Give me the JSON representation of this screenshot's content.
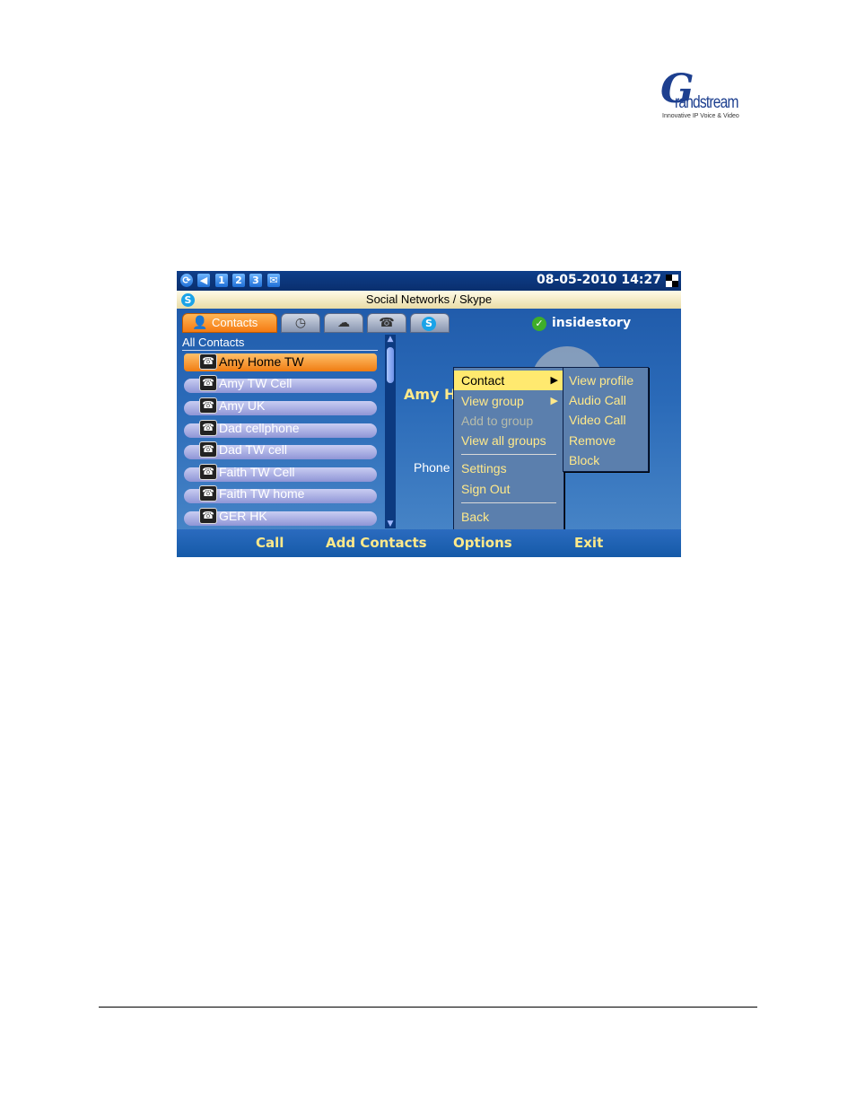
{
  "logo": {
    "letter": "G",
    "word": "randstream",
    "tagline": "Innovative IP Voice & Video"
  },
  "status_bar": {
    "icons": [
      "sync-icon",
      "volume-icon",
      "line-1",
      "line-2",
      "line-3",
      "message-icon"
    ],
    "lines": [
      "1",
      "2",
      "3"
    ],
    "datetime": "08-05-2010 14:27"
  },
  "title_bar": {
    "logo_letter": "S",
    "title": "Social Networks / Skype"
  },
  "tabs": [
    {
      "label": "Contacts",
      "icon": "contacts-icon",
      "active": true
    },
    {
      "label": "",
      "icon": "clock-icon",
      "active": false
    },
    {
      "label": "",
      "icon": "status-icon",
      "active": false
    },
    {
      "label": "",
      "icon": "phone-icon",
      "active": false
    },
    {
      "label": "",
      "icon": "skype-icon",
      "active": false
    }
  ],
  "user": {
    "name": "insidestory"
  },
  "list": {
    "header": "All Contacts",
    "contacts": [
      {
        "name": "Amy Home TW",
        "selected": true
      },
      {
        "name": "Amy TW Cell"
      },
      {
        "name": "Amy UK"
      },
      {
        "name": "Dad cellphone"
      },
      {
        "name": "Dad TW cell"
      },
      {
        "name": "Faith TW Cell"
      },
      {
        "name": "Faith TW home"
      },
      {
        "name": "GER HK"
      }
    ]
  },
  "detail": {
    "name": "Amy H",
    "phone_label": "Phone"
  },
  "menu": {
    "items": [
      {
        "label": "Contact",
        "submenu": true,
        "active": true
      },
      {
        "label": "View group",
        "submenu": true
      },
      {
        "label": "Add to group",
        "disabled": true
      },
      {
        "label": "View all groups"
      },
      {
        "label": "Settings"
      },
      {
        "label": "Sign Out"
      },
      {
        "label": "Back"
      }
    ]
  },
  "submenu": {
    "items": [
      "View profile",
      "Audio Call",
      "Video Call",
      "Remove",
      "Block"
    ]
  },
  "softkeys": [
    "Call",
    "Add Contacts",
    "Options",
    "Exit"
  ]
}
